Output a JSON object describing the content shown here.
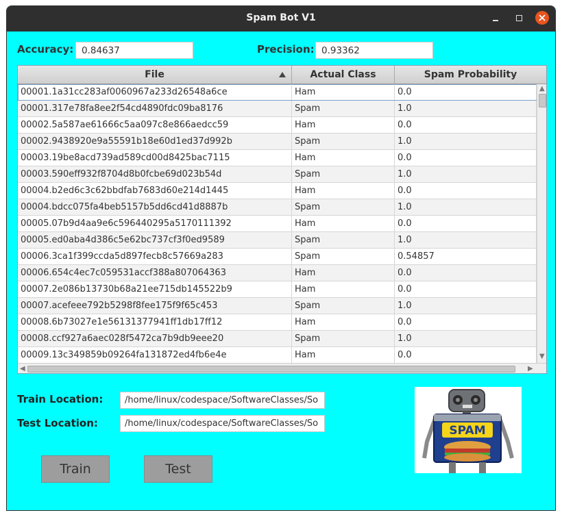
{
  "window": {
    "title": "Spam Bot V1"
  },
  "stats": {
    "accuracy_label": "Accuracy:",
    "accuracy_value": "0.84637",
    "precision_label": "Precision:",
    "precision_value": "0.93362"
  },
  "table": {
    "columns": [
      "File",
      "Actual Class",
      "Spam Probability"
    ],
    "sorted_column": "File",
    "rows": [
      [
        "00001.1a31cc283af0060967a233d26548a6ce",
        "Ham",
        "0.0"
      ],
      [
        "00001.317e78fa8ee2f54cd4890fdc09ba8176",
        "Spam",
        "1.0"
      ],
      [
        "00002.5a587ae61666c5aa097c8e866aedcc59",
        "Ham",
        "0.0"
      ],
      [
        "00002.9438920e9a55591b18e60d1ed37d992b",
        "Spam",
        "1.0"
      ],
      [
        "00003.19be8acd739ad589cd00d8425bac7115",
        "Ham",
        "0.0"
      ],
      [
        "00003.590eff932f8704d8b0fcbe69d023b54d",
        "Spam",
        "1.0"
      ],
      [
        "00004.b2ed6c3c62bbdfab7683d60e214d1445",
        "Ham",
        "0.0"
      ],
      [
        "00004.bdcc075fa4beb5157b5dd6cd41d8887b",
        "Spam",
        "1.0"
      ],
      [
        "00005.07b9d4aa9e6c596440295a5170111392",
        "Ham",
        "0.0"
      ],
      [
        "00005.ed0aba4d386c5e62bc737cf3f0ed9589",
        "Spam",
        "1.0"
      ],
      [
        "00006.3ca1f399ccda5d897fecb8c57669a283",
        "Spam",
        "0.54857"
      ],
      [
        "00006.654c4ec7c059531accf388a807064363",
        "Ham",
        "0.0"
      ],
      [
        "00007.2e086b13730b68a21ee715db145522b9",
        "Ham",
        "0.0"
      ],
      [
        "00007.acefeee792b5298f8fee175f9f65c453",
        "Spam",
        "1.0"
      ],
      [
        "00008.6b73027e1e56131377941ff1db17ff12",
        "Ham",
        "0.0"
      ],
      [
        "00008.ccf927a6aec028f5472ca7b9db9eee20",
        "Spam",
        "1.0"
      ],
      [
        "00009.13c349859b09264fa131872ed4fb6e4e",
        "Ham",
        "0.0"
      ]
    ]
  },
  "locations": {
    "train_label": "Train Location:",
    "train_value": "/home/linux/codespace/SoftwareClasses/So",
    "test_label": "Test Location:",
    "test_value": "/home/linux/codespace/SoftwareClasses/So"
  },
  "buttons": {
    "train": "Train",
    "test": "Test"
  },
  "mascot": {
    "can_text": "SPAM"
  },
  "colors": {
    "window_bg": "#00ffff",
    "titlebar_bg": "#2f2f2f",
    "close_btn": "#e95420",
    "button_bg": "#9d9d9d"
  }
}
